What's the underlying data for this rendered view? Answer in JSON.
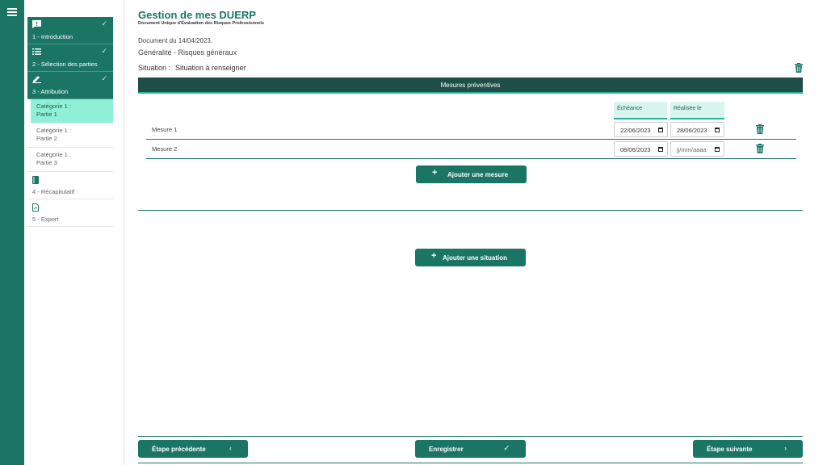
{
  "rail": {
    "menu_icon": "hamburger-icon"
  },
  "sidebar": {
    "steps": [
      {
        "label": "1 - Introduction",
        "icon": "feedback-icon",
        "done": true
      },
      {
        "label": "2 - Sélection des parties",
        "icon": "list-icon",
        "done": true
      },
      {
        "label": "3 - Attribution",
        "icon": "pencil-icon",
        "done": true
      }
    ],
    "categories": [
      {
        "line1": "Catégorie 1 :",
        "line2": "Partie 1",
        "selected": true
      },
      {
        "line1": "Catégorie 1 :",
        "line2": "Partie 2",
        "selected": false
      },
      {
        "line1": "Catégorie 1 :",
        "line2": "Partie 3",
        "selected": false
      }
    ],
    "later_steps": [
      {
        "label": "4 - Récapitulatif",
        "icon": "book-icon"
      },
      {
        "label": "5 - Export",
        "icon": "pdf-file-icon"
      }
    ]
  },
  "header": {
    "title": "Gestion de mes DUERP",
    "subtitle": "Document Unique d'Évaluation des Risques Professionnels",
    "doc_date": "Document du 14/04/2023.",
    "context": "Généralité - Risques généraux"
  },
  "situation": {
    "label": "Situation :",
    "value": "Situation à renseigner"
  },
  "mesures": {
    "header": "Mesures préventives",
    "col_echeance": "Échéance",
    "col_realisee": "Réalisée le",
    "rows": [
      {
        "name": "Mesure 1",
        "echeance": "22/06/2023",
        "realisee": "28/06/2023"
      },
      {
        "name": "Mesure 2",
        "echeance": "08/06/2023",
        "realisee": "jj/mm/aaaa"
      }
    ],
    "add_label": "Ajouter une mesure"
  },
  "add_situation_label": "Ajouter une situation",
  "footer": {
    "prev_label": "Étape précédente",
    "save_label": "Enregistrer",
    "next_label": "Étape suivante"
  },
  "colors": {
    "primary": "#1a7565",
    "header_dark": "#1d4f46",
    "accent": "#29b39a",
    "selected": "#8ff0d8"
  }
}
